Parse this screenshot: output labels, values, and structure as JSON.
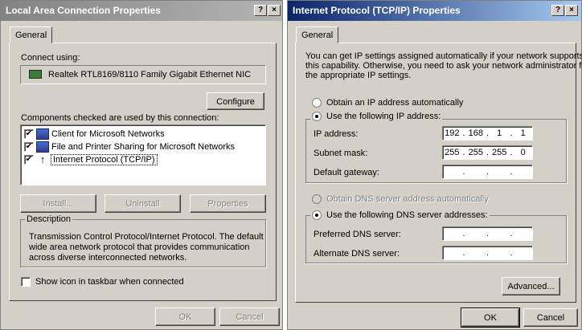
{
  "dialog1": {
    "title": "Local Area Connection Properties",
    "help_btn": "?",
    "close_btn": "×",
    "tab": "General",
    "connect_using_label": "Connect using:",
    "adapter_name": "Realtek RTL8169/8110 Family Gigabit Ethernet NIC",
    "configure_label": "Configure",
    "components_label": "Components checked are used by this connection:",
    "components": [
      {
        "label": "Client for Microsoft Networks",
        "checked": true,
        "icon": "network-client-icon"
      },
      {
        "label": "File and Printer Sharing for Microsoft Networks",
        "checked": true,
        "icon": "file-sharing-icon"
      },
      {
        "label": "Internet Protocol (TCP/IP)",
        "checked": true,
        "icon": "protocol-icon"
      }
    ],
    "install_label": "Install...",
    "uninstall_label": "Uninstall",
    "properties_label": "Properties",
    "description_label": "Description",
    "description_text": [
      "Transmission Control Protocol/Internet Protocol. The default",
      "wide area network protocol that provides communication",
      "across diverse interconnected networks."
    ],
    "show_icon_label": "Show icon in taskbar when connected",
    "ok_label": "OK",
    "cancel_label": "Cancel"
  },
  "dialog2": {
    "title": "Internet Protocol (TCP/IP) Properties",
    "help_btn": "?",
    "close_btn": "×",
    "tab": "General",
    "intro": [
      "You can get IP settings assigned automatically if your network supports",
      "this capability. Otherwise, you need to ask your network administrator for",
      "the appropriate IP settings."
    ],
    "obtain_ip_auto": "Obtain an IP address automatically",
    "use_following_ip": "Use the following IP address:",
    "ip_address_label": "IP address:",
    "ip_address": [
      "192",
      "168",
      "1",
      "1"
    ],
    "subnet_label": "Subnet mask:",
    "subnet": [
      "255",
      "255",
      "255",
      "0"
    ],
    "gateway_label": "Default gateway:",
    "gateway": [
      "",
      "",
      "",
      ""
    ],
    "obtain_dns_auto": "Obtain DNS server address automatically",
    "use_following_dns": "Use the following DNS server addresses:",
    "preferred_dns_label": "Preferred DNS server:",
    "preferred_dns": [
      "",
      "",
      "",
      ""
    ],
    "alternate_dns_label": "Alternate DNS server:",
    "alternate_dns": [
      "",
      "",
      "",
      ""
    ],
    "advanced_label": "Advanced...",
    "ok_label": "OK",
    "cancel_label": "Cancel"
  }
}
